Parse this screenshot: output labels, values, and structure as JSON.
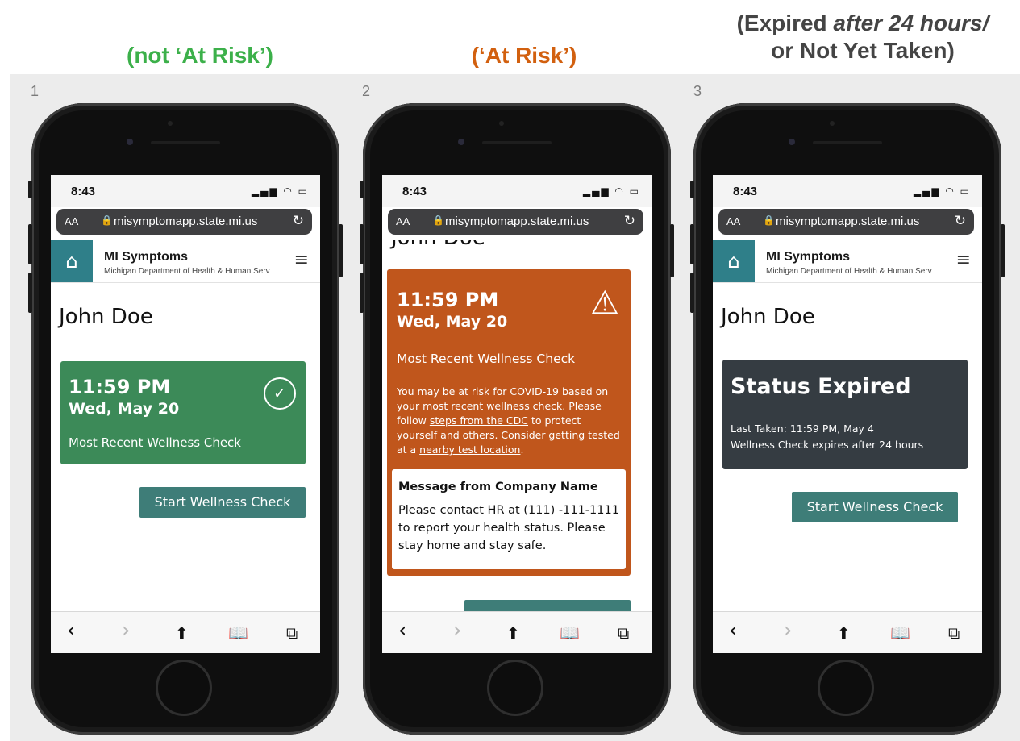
{
  "headings": {
    "h1": "(not ‘At Risk’)",
    "h2": "(‘At Risk’)",
    "h3_line1_a": "(Expired ",
    "h3_line1_b": "after 24 hours/",
    "h3_line2": "or Not Yet Taken)"
  },
  "frames": [
    "1",
    "2",
    "3"
  ],
  "browser": {
    "time": "8:43",
    "signal_icons": "▂▄▆ ◠ ▭",
    "aa": "AA",
    "lock": "🔒",
    "url": "misymptomapp.state.mi.us",
    "reload": "↻"
  },
  "app": {
    "logo": "⌂",
    "title": "MI Symptoms",
    "subtitle": "Michigan Department of Health & Human Services",
    "menu": "≡",
    "user_name": "John Doe"
  },
  "phone1": {
    "time": "11:59 PM",
    "date": "Wed, May 20",
    "label": "Most Recent Wellness Check",
    "check": "✓",
    "button": "Start Wellness Check"
  },
  "phone2": {
    "cut_name": "John Doe",
    "time": "11:59 PM",
    "date": "Wed, May 20",
    "label": "Most Recent Wellness Check",
    "warn": "⚠",
    "body_1": "You may be at risk for COVID-19 based on your most recent wellness check. Please follow ",
    "link_1": "steps from the CDC",
    "body_2": " to protect yourself and others. Consider getting tested at a ",
    "link_2": "nearby test location",
    "body_3": ".",
    "message_title": "Message from Company Name",
    "message_body": "Please contact HR at (111) -111-1111 to report your health status. Please stay home and stay safe."
  },
  "phone3": {
    "title": "Status Expired",
    "last_taken": "Last Taken: 11:59 PM, May 4",
    "expires": "Wellness Check expires after 24 hours",
    "button": "Start Wellness Check"
  },
  "toolbar": {
    "back": "‹",
    "forward": "›",
    "share": "⬆",
    "bookmarks": "📖",
    "tabs": "⧉"
  }
}
